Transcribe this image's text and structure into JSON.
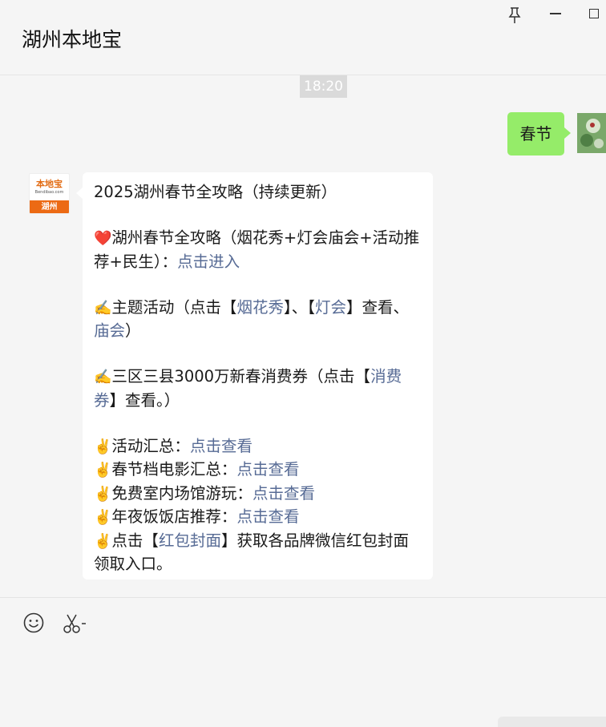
{
  "header": {
    "title": "湖州本地宝"
  },
  "chat": {
    "time": "18:20",
    "my_message": "春节",
    "bot_avatar": {
      "brand": "本地宝",
      "sub": "Bendibao.com",
      "city": "湖州"
    },
    "message": {
      "title": "2025湖州春节全攻略（持续更新）",
      "p1_text": "湖州春节全攻略（烟花秀+灯会庙会+活动推荐+民生）：",
      "p1_link": "点击进入",
      "p2_a": "主题活动（点击【",
      "p2_link1": "烟花秀",
      "p2_b": "】、【",
      "p2_link2": "灯会",
      "p2_c": "】查看、",
      "p2_link3": "庙会",
      "p2_d": "）",
      "p3_a": "三区三县3000万新春消费券（点击【",
      "p3_link": "消费券",
      "p3_b": "】查看。）",
      "items": [
        {
          "text": "活动汇总：",
          "link": "点击查看"
        },
        {
          "text": "春节档电影汇总：",
          "link": "点击查看"
        },
        {
          "text": "免费室内场馆游玩：",
          "link": "点击查看"
        },
        {
          "text": "年夜饭饭店推荐：",
          "link": "点击查看"
        }
      ],
      "last_a": "点击【",
      "last_link": "红包封面",
      "last_b": "】获取各品牌微信红包封面领取入口。"
    }
  },
  "icons": {
    "heart": "❤️",
    "writing_hand": "✍️",
    "victory_hand": "✌️"
  }
}
